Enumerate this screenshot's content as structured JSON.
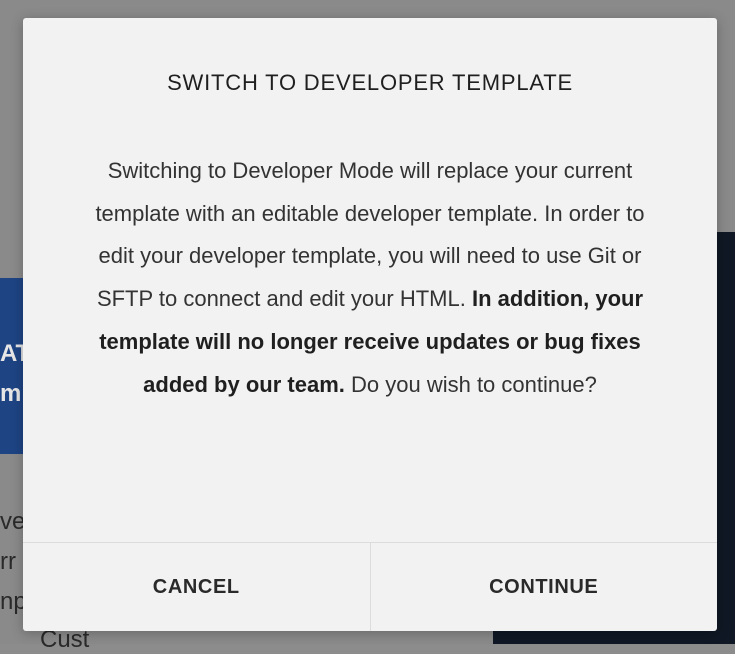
{
  "background": {
    "fragments": [
      "AT",
      "m",
      "ve",
      "rr",
      "np",
      "Cust"
    ]
  },
  "dialog": {
    "title": "SWITCH TO DEVELOPER TEMPLATE",
    "body_regular": "Switching to Developer Mode will replace your current template with an editable developer template. In order to edit your developer template, you will need to use Git or SFTP to connect and edit your HTML.",
    "body_bold": "In addition, your template will no longer receive updates or bug fixes added by our team.",
    "body_end": "Do you wish to continue?",
    "cancel_label": "CANCEL",
    "continue_label": "CONTINUE"
  }
}
